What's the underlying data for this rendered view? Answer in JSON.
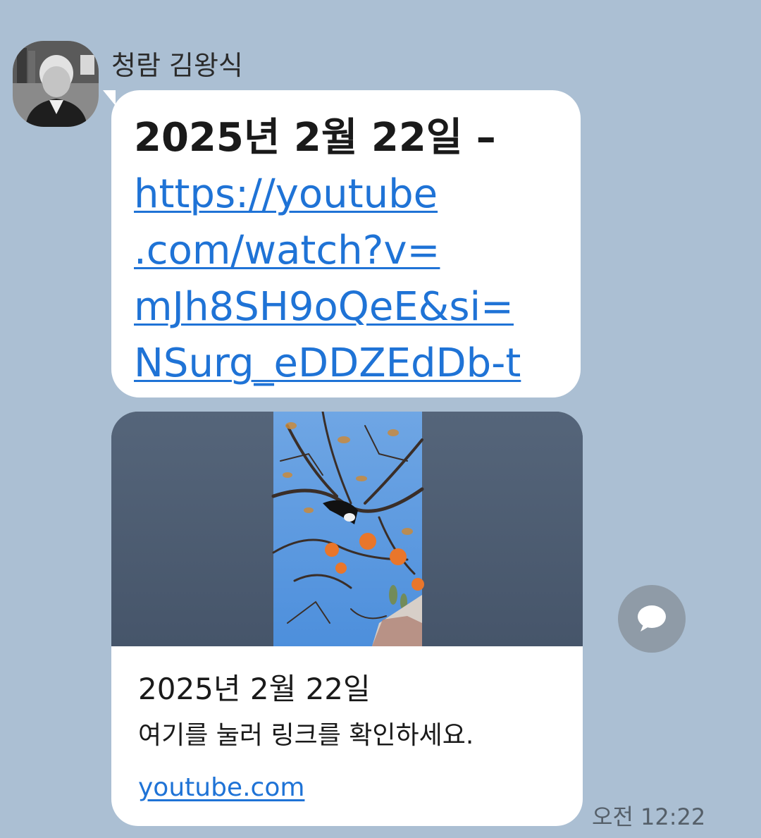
{
  "sender": {
    "name": "청람 김왕식",
    "avatar_icon": "profile-photo"
  },
  "message": {
    "heading": "2025년 2월 22일 –",
    "link_lines": [
      "https://youtube",
      ".com/watch?v=",
      "mJh8SH9oQeE&si=",
      "NSurg_eDDZEdDb-t"
    ]
  },
  "preview_card": {
    "title": "2025년 2월 22일",
    "description": "여기를 눌러 링크를 확인하세요.",
    "domain": "youtube.com",
    "thumbnail_icon": "persimmon-tree-magpie-image"
  },
  "share_button_icon": "speech-bubble-icon",
  "timestamp": "오전 12:22",
  "colors": {
    "background": "#abbfd3",
    "link": "#1f73d6",
    "bubble": "#ffffff",
    "share_button": "#8f9ba7"
  }
}
